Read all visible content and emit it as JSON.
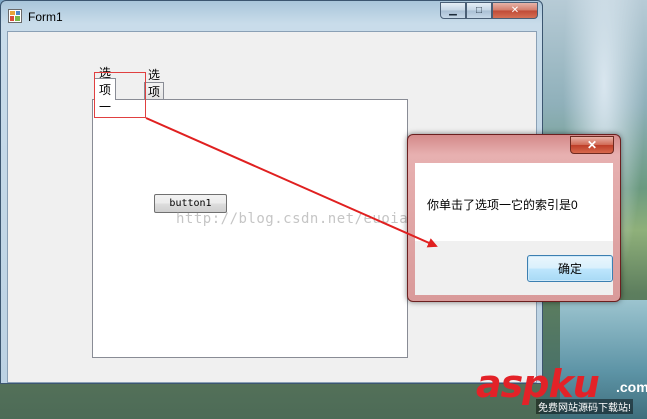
{
  "window": {
    "title": "Form1",
    "minimize_glyph": "▁",
    "maximize_glyph": "□",
    "close_glyph": "✕"
  },
  "tabs": [
    {
      "label": "选项一",
      "selected": true
    },
    {
      "label": "选项二",
      "selected": false
    }
  ],
  "panel": {
    "button_label": "button1"
  },
  "watermark": "http://blog.csdn.net/euoian1992",
  "message_box": {
    "close_glyph": "✕",
    "message": "你单击了选项一它的索引是0",
    "ok_label": "确定"
  },
  "logo": {
    "asp": "asp",
    "ku": "ku",
    "com": ".com",
    "tagline": "免费网站源码下载站!"
  },
  "colors": {
    "annotation_red": "#e02020",
    "logo_red": "#e32228"
  }
}
